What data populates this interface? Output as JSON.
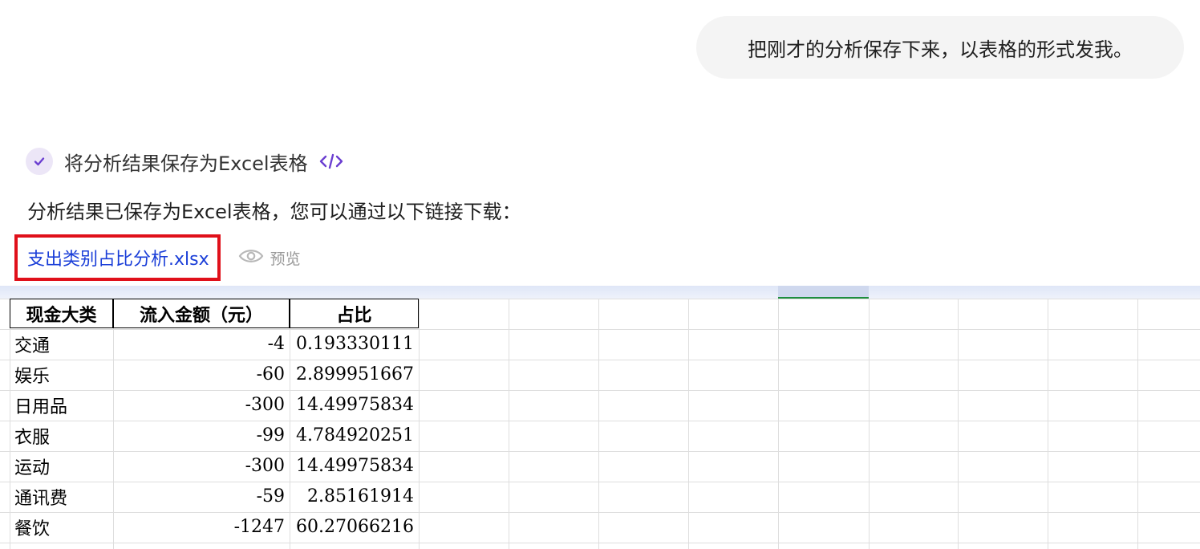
{
  "user_message": "把刚才的分析保存下来，以表格的形式发我。",
  "step": {
    "label": "将分析结果保存为Excel表格",
    "code_icon": "code-icon",
    "status_icon": "check-icon"
  },
  "answer_text": "分析结果已保存为Excel表格，您可以通过以下链接下载：",
  "file": {
    "name": "支出类别占比分析.xlsx",
    "preview_label": "预览"
  },
  "table": {
    "headers": [
      "现金大类",
      "流入金额（元）",
      "占比"
    ],
    "rows": [
      [
        "交通",
        "-4",
        "0.193330111"
      ],
      [
        "娱乐",
        "-60",
        "2.899951667"
      ],
      [
        "日用品",
        "-300",
        "14.49975834"
      ],
      [
        "衣服",
        "-99",
        "4.784920251"
      ],
      [
        "运动",
        "-300",
        "14.49975834"
      ],
      [
        "通讯费",
        "-59",
        "2.85161914"
      ],
      [
        "餐饮",
        "-1247",
        "60.27066216"
      ]
    ]
  },
  "colors": {
    "highlight_border": "#e0101a",
    "link": "#1a3ed8",
    "accent": "#6b3fd1"
  }
}
